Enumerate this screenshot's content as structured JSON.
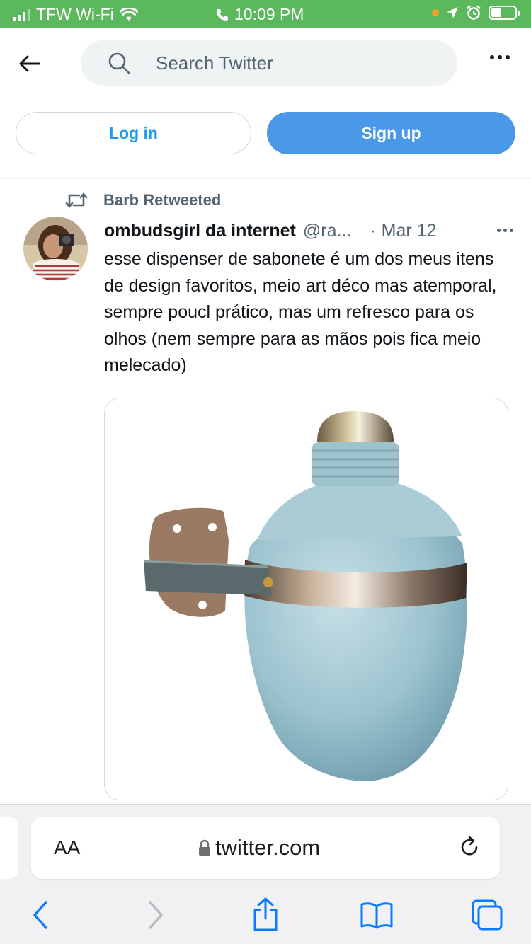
{
  "status_bar": {
    "carrier": "TFW Wi-Fi",
    "time": "10:09 PM",
    "icons": [
      "signal-bars-icon",
      "wifi-icon",
      "phone-icon",
      "location-arrow-icon",
      "alarm-icon",
      "battery-icon"
    ]
  },
  "header": {
    "search_placeholder": "Search Twitter",
    "icons": [
      "back-arrow-icon",
      "search-icon",
      "more-icon"
    ]
  },
  "auth": {
    "login_label": "Log in",
    "signup_label": "Sign up",
    "signup_color": "#4a99e9",
    "login_text_color": "#1d9bf0"
  },
  "tweet": {
    "retweet_label": "Barb Retweeted",
    "author_name": "ombudsgirl da internet",
    "author_handle": "@ra...",
    "separator": "·",
    "date": "Mar 12",
    "text": "esse dispenser de sabonete é um dos meus itens de design favoritos, meio art déco mas atemporal, sempre poucl prático, mas um refresco para os olhos (nem sempre para as mãos pois fica meio melecado)",
    "media_alt_icon": "soap-dispenser-photo"
  },
  "safari": {
    "text_size_label": "AA",
    "url": "twitter.com",
    "icons": [
      "lock-icon",
      "reload-icon",
      "back-icon",
      "forward-icon",
      "share-icon",
      "bookmarks-icon",
      "tabs-icon"
    ],
    "accent": "#0a7aff"
  }
}
